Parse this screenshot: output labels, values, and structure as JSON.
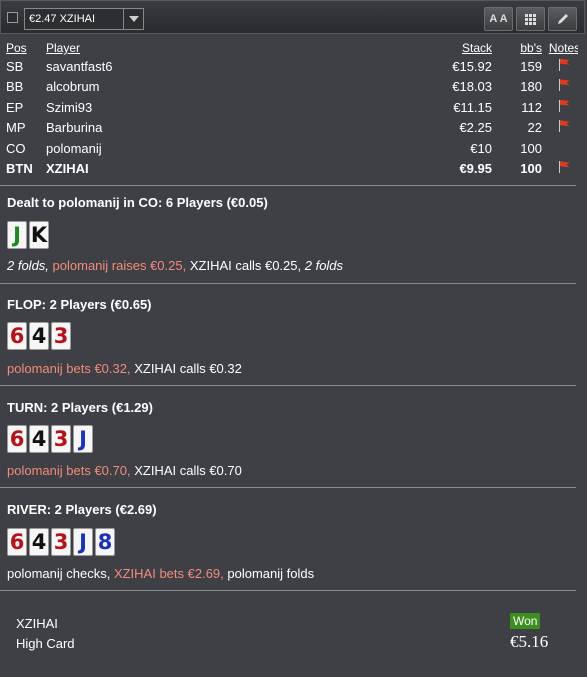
{
  "toolbar": {
    "selected_hand": "€2.47 XZIHAI",
    "font_button_label": "A A",
    "grid_icon": "grid-icon",
    "edit_icon": "pencil-icon"
  },
  "players_table": {
    "headers": {
      "pos": "Pos",
      "player": "Player",
      "stack": "Stack",
      "bbs": "bb's",
      "notes": "Notes"
    },
    "rows": [
      {
        "pos": "SB",
        "name": "savantfast6",
        "stack": "€15.92",
        "bb": "159",
        "note_flag": true
      },
      {
        "pos": "BB",
        "name": "alcobrum",
        "stack": "€18.03",
        "bb": "180",
        "note_flag": true
      },
      {
        "pos": "EP",
        "name": "Szimi93",
        "stack": "€11.15",
        "bb": "112",
        "note_flag": true
      },
      {
        "pos": "MP",
        "name": "Barburina",
        "stack": "€2.25",
        "bb": "22",
        "note_flag": true
      },
      {
        "pos": "CO",
        "name": "polomanij",
        "stack": "€10",
        "bb": "100",
        "note_flag": false
      },
      {
        "pos": "BTN",
        "name": "XZIHAI",
        "stack": "€9.95",
        "bb": "100",
        "note_flag": true,
        "bold": true
      }
    ]
  },
  "preflop": {
    "title": "Dealt to polomanij in CO: 6 Players (€0.05)",
    "cards": [
      {
        "rank": "J",
        "color": "#1c8a1c"
      },
      {
        "rank": "K",
        "color": "#111111"
      }
    ],
    "action_1": "2 folds,",
    "action_2": " polomanij raises €0.25,",
    "action_3": " XZIHAI calls €0.25,",
    "action_4": " 2 folds"
  },
  "flop": {
    "title": "FLOP: 2 Players (€0.65)",
    "cards": [
      {
        "rank": "6",
        "color": "#b5121b"
      },
      {
        "rank": "4",
        "color": "#111111"
      },
      {
        "rank": "3",
        "color": "#b5121b"
      }
    ],
    "action_1": "polomanij bets €0.32,",
    "action_2": " XZIHAI calls €0.32"
  },
  "turn": {
    "title": "TURN: 2 Players (€1.29)",
    "cards": [
      {
        "rank": "6",
        "color": "#b5121b"
      },
      {
        "rank": "4",
        "color": "#111111"
      },
      {
        "rank": "3",
        "color": "#b5121b"
      },
      {
        "rank": "J",
        "color": "#1a33b8"
      }
    ],
    "action_1": "polomanij bets €0.70,",
    "action_2": " XZIHAI calls €0.70"
  },
  "river": {
    "title": "RIVER: 2 Players (€2.69)",
    "cards": [
      {
        "rank": "6",
        "color": "#b5121b"
      },
      {
        "rank": "4",
        "color": "#111111"
      },
      {
        "rank": "3",
        "color": "#b5121b"
      },
      {
        "rank": "J",
        "color": "#1a33b8"
      },
      {
        "rank": "8",
        "color": "#1a33b8"
      }
    ],
    "action_1": "polomanij checks,",
    "action_2": " XZIHAI bets €2.69,",
    "action_3": " polomanij folds"
  },
  "summary": {
    "winner": "XZIHAI",
    "hand": "High Card",
    "badge": "Won",
    "amount": "€5.16"
  }
}
